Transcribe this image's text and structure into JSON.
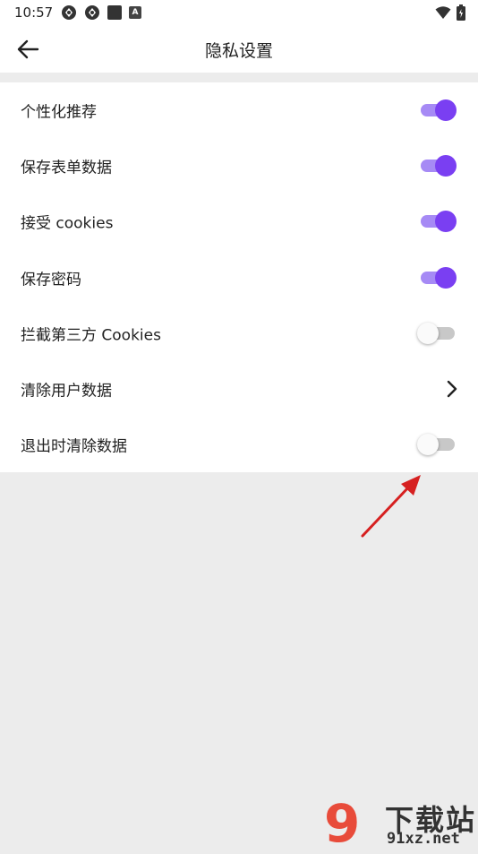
{
  "status_bar": {
    "time": "10:57",
    "left_icons": [
      "nfc-icon",
      "nfc-icon",
      "square-icon",
      "a-icon"
    ],
    "a_icon_text": "A",
    "right_icons": [
      "wifi-icon",
      "battery-icon"
    ]
  },
  "app_bar": {
    "back_icon": "arrow-left-icon",
    "title": "隐私设置"
  },
  "settings": [
    {
      "label": "个性化推荐",
      "control": "switch",
      "on": true
    },
    {
      "label": "保存表单数据",
      "control": "switch",
      "on": true
    },
    {
      "label": "接受 cookies",
      "control": "switch",
      "on": true
    },
    {
      "label": "保存密码",
      "control": "switch",
      "on": true
    },
    {
      "label": "拦截第三方 Cookies",
      "control": "switch",
      "on": false
    },
    {
      "label": "清除用户数据",
      "control": "chevron",
      "icon": "chevron-right-icon"
    },
    {
      "label": "退出时清除数据",
      "control": "switch",
      "on": false
    }
  ],
  "annotation": {
    "type": "red-arrow",
    "color": "#d62020"
  },
  "watermark": {
    "nine": "9",
    "cn": "下载站",
    "url": "91xz.net"
  },
  "colors": {
    "accent": "#7a3ff2",
    "accent_track": "#a68af5",
    "off_track": "#c8c8c8",
    "background": "#ececec"
  }
}
